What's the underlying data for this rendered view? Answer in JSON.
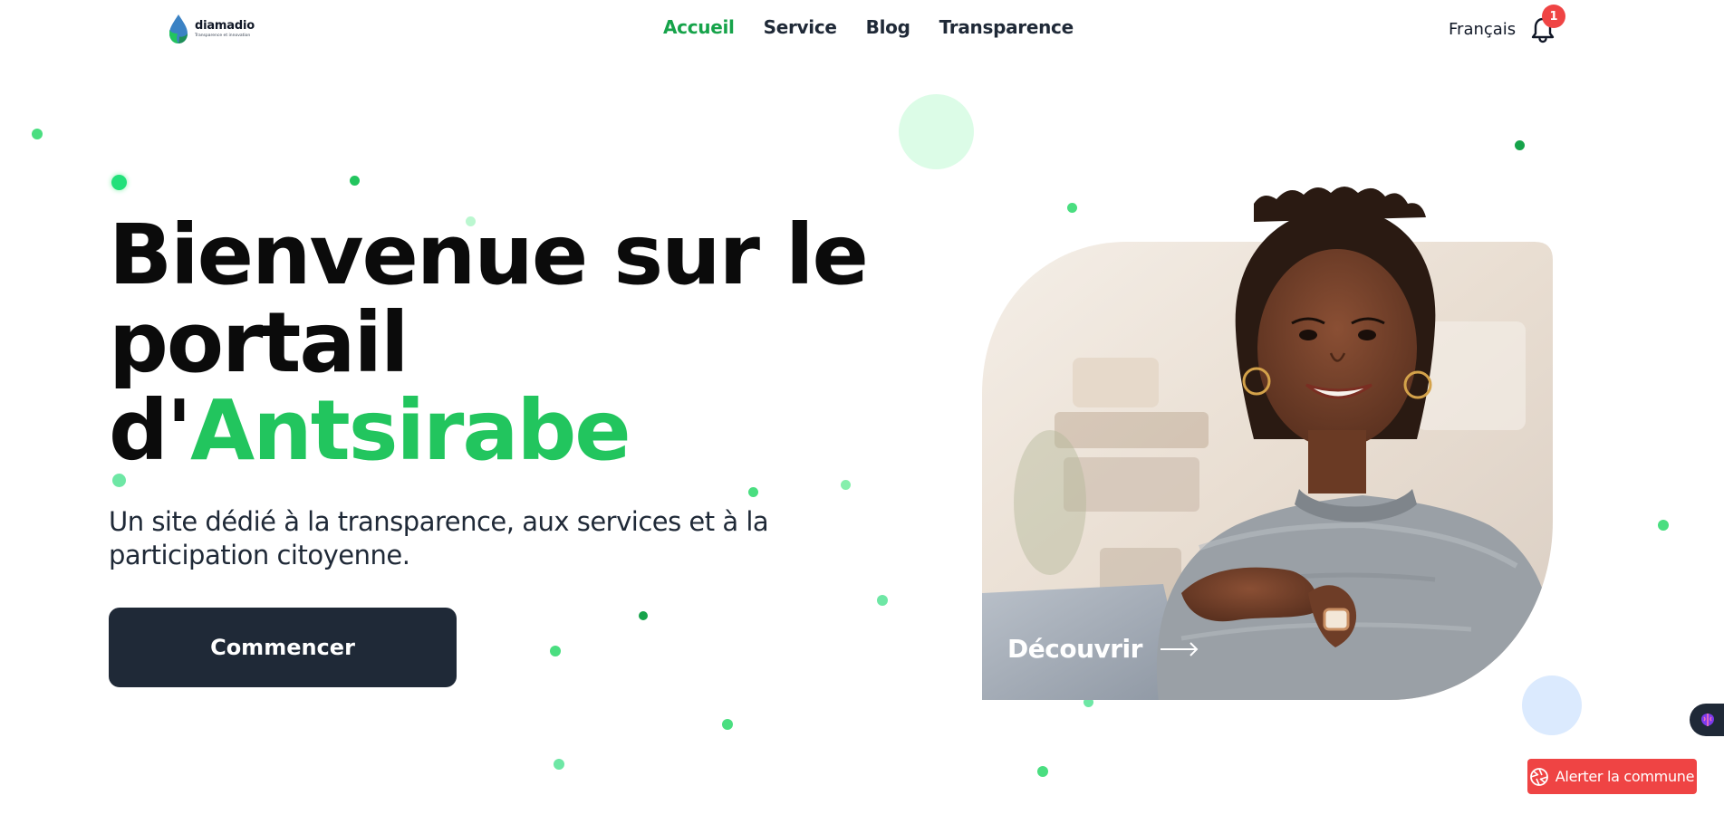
{
  "brand": {
    "name": "diamadio",
    "tagline": "Transparence et innovation",
    "logo_icon": "water-drop-icon"
  },
  "nav": {
    "items": [
      {
        "label": "Accueil",
        "active": true
      },
      {
        "label": "Service",
        "active": false
      },
      {
        "label": "Blog",
        "active": false
      },
      {
        "label": "Transparence",
        "active": false
      }
    ]
  },
  "header": {
    "language": "Français",
    "notification_icon": "bell-icon",
    "notification_count": "1"
  },
  "hero": {
    "title_line1": "Bienvenue sur le",
    "title_line2": "portail",
    "title_prefix": "d'",
    "title_highlight": "Antsirabe",
    "subtitle": "Un site dédié à la transparence, aux services et à la participation citoyenne.",
    "cta_label": "Commencer",
    "image_icon": "woman-portrait-photo",
    "discover_label": "Découvrir",
    "discover_icon": "arrow-right-icon"
  },
  "widgets": {
    "side_icon": "brain-icon",
    "alert_label": "Alerter la commune",
    "alert_icon": "aperture-icon"
  },
  "colors": {
    "accent": "#22c55e",
    "nav_active": "#16a34a",
    "cta_bg": "#1f2937",
    "alert": "#ef4444",
    "badge": "#ef4444"
  }
}
